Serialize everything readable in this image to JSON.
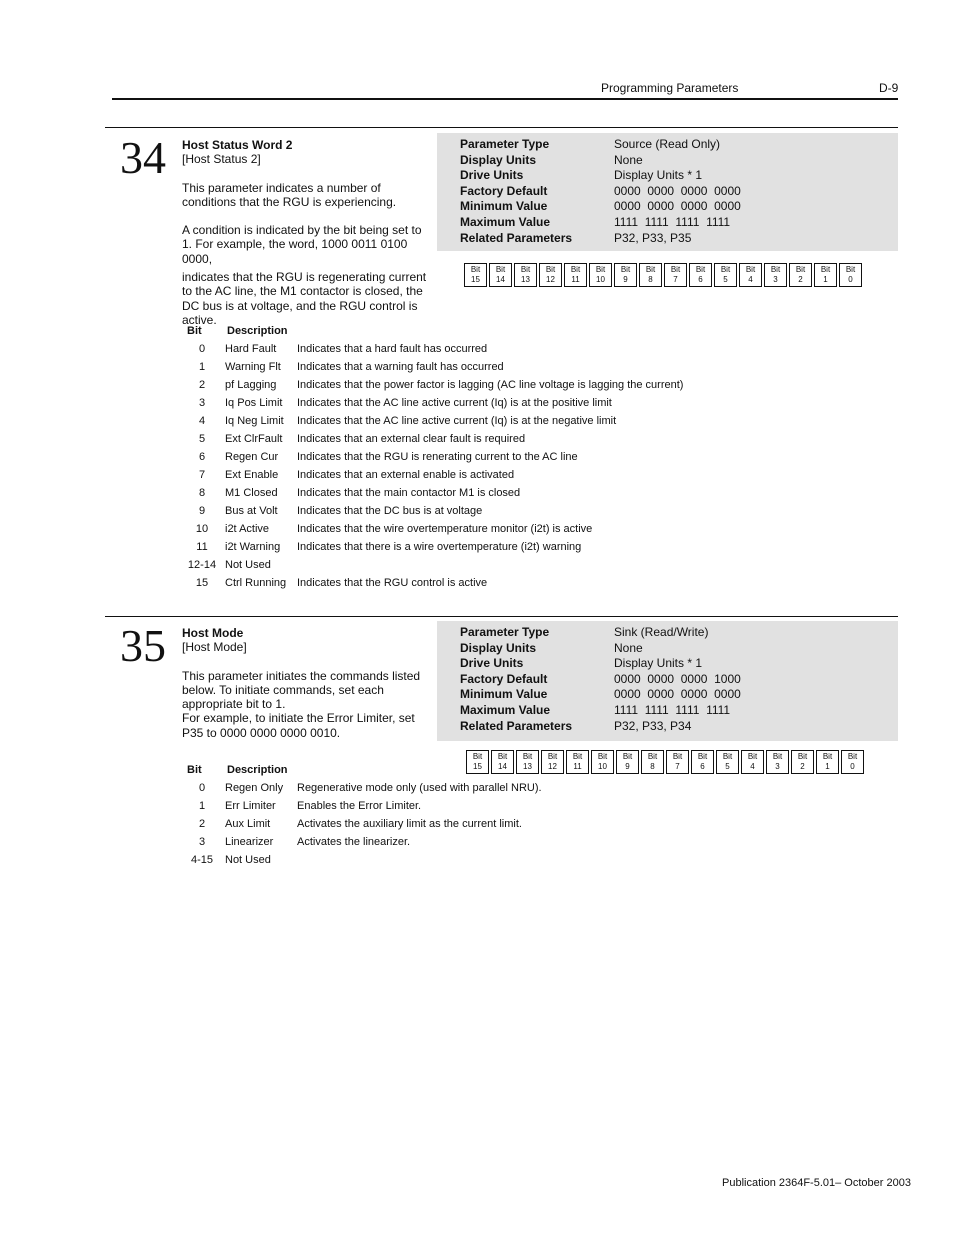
{
  "header": {
    "section_title": "Programming Parameters",
    "page_number": "D-9"
  },
  "params": [
    {
      "number": "34",
      "name": "Host Status Word 2",
      "short_name": "[Host Status 2]",
      "desc_1": "This parameter indicates a number of conditions that the RGU is experiencing.",
      "desc_2": "A condition is indicated by the bit being set to 1. For example, the word, 1000 0011 0100 0000,",
      "desc_3": "indicates that the RGU is regenerating current to the AC line, the M1 contactor is closed, the DC bus is at voltage, and the RGU control is active.",
      "info": [
        {
          "label": "Parameter Type",
          "value": "Source (Read Only)"
        },
        {
          "label": "Display Units",
          "value": "None"
        },
        {
          "label": "Drive Units",
          "value": "Display Units * 1"
        },
        {
          "label": "Factory Default",
          "value": "0000  0000  0000  0000"
        },
        {
          "label": "Minimum Value",
          "value": "0000  0000  0000  0000"
        },
        {
          "label": "Maximum Value",
          "value": "1111  1111  1111  1111"
        },
        {
          "label": "Related Parameters",
          "value": "P32, P33, P35"
        }
      ],
      "table_header": {
        "bit": "Bit",
        "description": "Description"
      },
      "bit_rows": [
        {
          "bit": "0",
          "name": "Hard Fault",
          "desc": "Indicates that a hard fault has occurred"
        },
        {
          "bit": "1",
          "name": "Warning Flt",
          "desc": "Indicates that a warning fault has occurred"
        },
        {
          "bit": "2",
          "name": "pf Lagging",
          "desc": "Indicates that the power factor is lagging (AC line voltage is lagging the current)"
        },
        {
          "bit": "3",
          "name": "Iq Pos Limit",
          "desc": "Indicates that the AC line active current (Iq) is at the positive limit"
        },
        {
          "bit": "4",
          "name": "Iq Neg Limit",
          "desc": "Indicates that the AC line active current (Iq) is at the negative limit"
        },
        {
          "bit": "5",
          "name": "Ext ClrFault",
          "desc": "Indicates that an external clear fault is required"
        },
        {
          "bit": "6",
          "name": "Regen Cur",
          "desc": "Indicates that the RGU is renerating current to the AC line"
        },
        {
          "bit": "7",
          "name": "Ext Enable",
          "desc": "Indicates that an external enable is activated"
        },
        {
          "bit": "8",
          "name": "M1 Closed",
          "desc": "Indicates that the main contactor M1 is closed"
        },
        {
          "bit": "9",
          "name": "Bus at Volt",
          "desc": "Indicates that the DC bus is at voltage"
        },
        {
          "bit": "10",
          "name": "i2t Active",
          "desc": "Indicates that the wire overtemperature monitor (i2t) is active"
        },
        {
          "bit": "11",
          "name": "i2t Warning",
          "desc": "Indicates that there is a wire overtemperature (i2t) warning"
        },
        {
          "bit": "12-14",
          "name": "Not Used",
          "desc": ""
        },
        {
          "bit": "15",
          "name": "Ctrl Running",
          "desc": "Indicates that the RGU control is active"
        }
      ]
    },
    {
      "number": "35",
      "name": "Host Mode",
      "short_name": "[Host Mode]",
      "desc_1": "This parameter initiates the commands listed below.  To initiate commands, set each appropriate bit to 1.",
      "desc_2": "For example, to initiate the Error Limiter, set P35 to 0000 0000 0000 0010.",
      "info": [
        {
          "label": "Parameter Type",
          "value": "Sink (Read/Write)"
        },
        {
          "label": "Display Units",
          "value": "None"
        },
        {
          "label": "Drive Units",
          "value": "Display Units * 1"
        },
        {
          "label": "Factory Default",
          "value": "0000  0000  0000  1000"
        },
        {
          "label": "Minimum Value",
          "value": "0000  0000  0000  0000"
        },
        {
          "label": "Maximum Value",
          "value": "1111  1111  1111  1111"
        },
        {
          "label": "Related Parameters",
          "value": "P32, P33, P34"
        }
      ],
      "table_header": {
        "bit": "Bit",
        "description": "Description"
      },
      "bit_rows": [
        {
          "bit": "0",
          "name": "Regen Only",
          "desc": "Regenerative mode only (used with parallel NRU)."
        },
        {
          "bit": "1",
          "name": "Err Limiter",
          "desc": "Enables the Error Limiter."
        },
        {
          "bit": "2",
          "name": "Aux Limit",
          "desc": "Activates the auxiliary limit as the current limit."
        },
        {
          "bit": "3",
          "name": "Linearizer",
          "desc": "Activates the linearizer."
        },
        {
          "bit": "4-15",
          "name": "Not Used",
          "desc": ""
        }
      ]
    }
  ],
  "bit_boxes": {
    "label": "Bit",
    "numbers": [
      "15",
      "14",
      "13",
      "12",
      "11",
      "10",
      "9",
      "8",
      "7",
      "6",
      "5",
      "4",
      "3",
      "2",
      "1",
      "0"
    ]
  },
  "footer": {
    "publication": "Publication 2364F-5.01– October 2003"
  }
}
